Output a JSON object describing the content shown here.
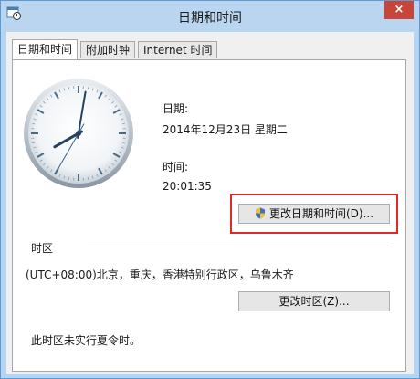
{
  "window": {
    "title": "日期和时间",
    "close_glyph": "×",
    "icon": "datetime-app-icon"
  },
  "tabs": [
    {
      "label": "日期和时间",
      "active": true
    },
    {
      "label": "附加时钟",
      "active": false
    },
    {
      "label": "Internet 时间",
      "active": false
    }
  ],
  "date_section": {
    "date_label": "日期:",
    "date_value": "2014年12月23日 星期二",
    "time_label": "时间:",
    "time_value": "20:01:35"
  },
  "clock": {
    "hours": 20,
    "minutes": 1,
    "seconds": 35
  },
  "buttons": {
    "change_datetime": "更改日期和时间(D)...",
    "change_timezone": "更改时区(Z)..."
  },
  "timezone": {
    "heading": "时区",
    "value": "(UTC+08:00)北京，重庆，香港特别行政区，乌鲁木齐",
    "dst_note": "此时区未实行夏令时。"
  },
  "colors": {
    "highlight": "#e0292b",
    "title_bar": "#b9d5ef",
    "close_button": "#c7463a"
  }
}
